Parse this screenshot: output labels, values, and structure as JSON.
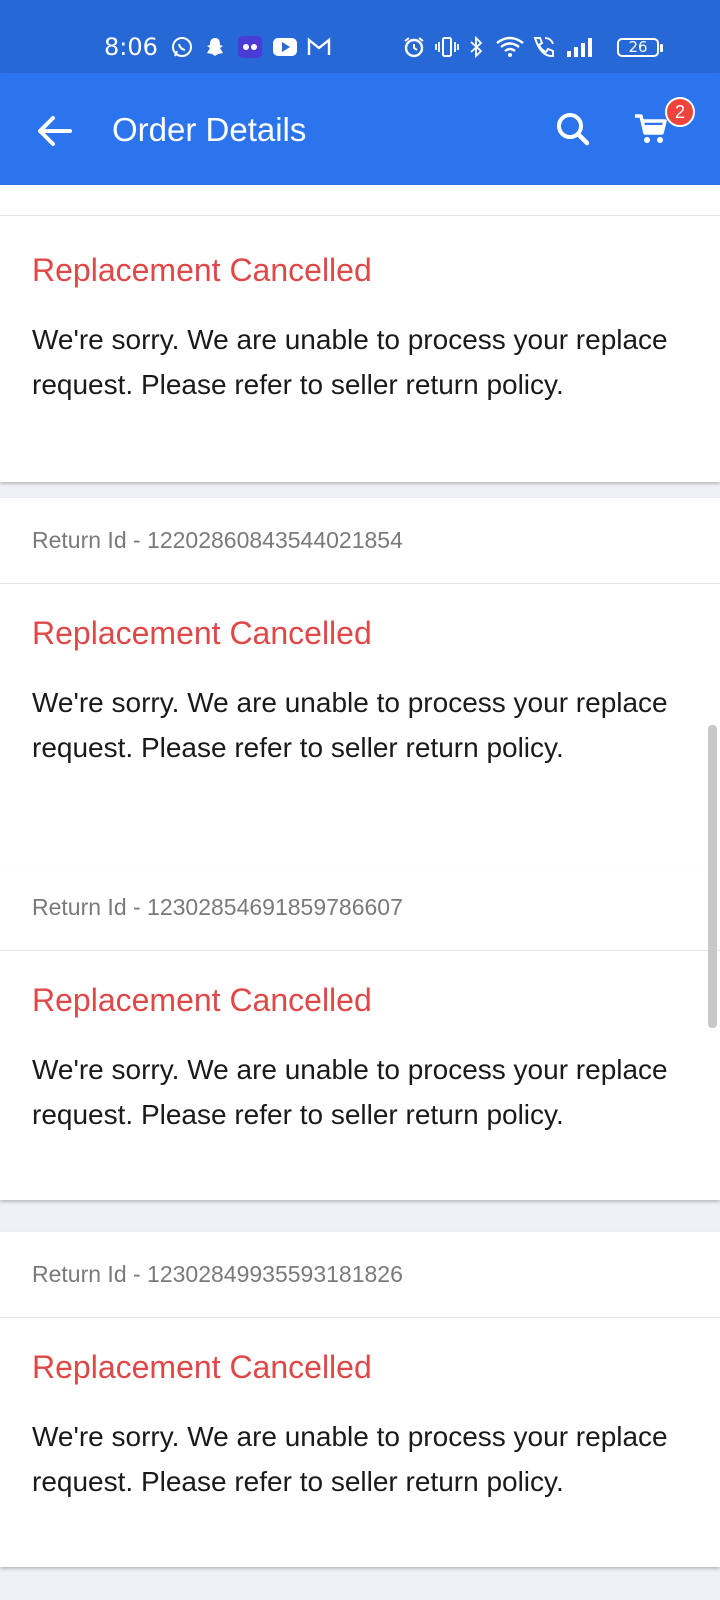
{
  "status_bar": {
    "time": "8:06",
    "battery": "26",
    "icons": [
      "whatsapp-icon",
      "snapchat-icon",
      "app-icon",
      "youtube-icon",
      "gmail-icon",
      "alarm-icon",
      "vibrate-icon",
      "bluetooth-icon",
      "wifi-icon",
      "wifi-call-icon",
      "signal-icon",
      "battery-icon"
    ]
  },
  "app_bar": {
    "title": "Order Details",
    "cart_count": "2",
    "color": "#2b74ee"
  },
  "cancel_status": {
    "title": "Replacement Cancelled",
    "message": "We're sorry. We are unable to process your replace request. Please refer to seller return policy.",
    "title_color": "#e04848"
  },
  "returns": [
    {
      "return_id": "Return Id - 12202860843544021854"
    },
    {
      "return_id": "Return Id - 12302854691859786607"
    },
    {
      "return_id": "Return Id - 12302849935593181826"
    }
  ]
}
